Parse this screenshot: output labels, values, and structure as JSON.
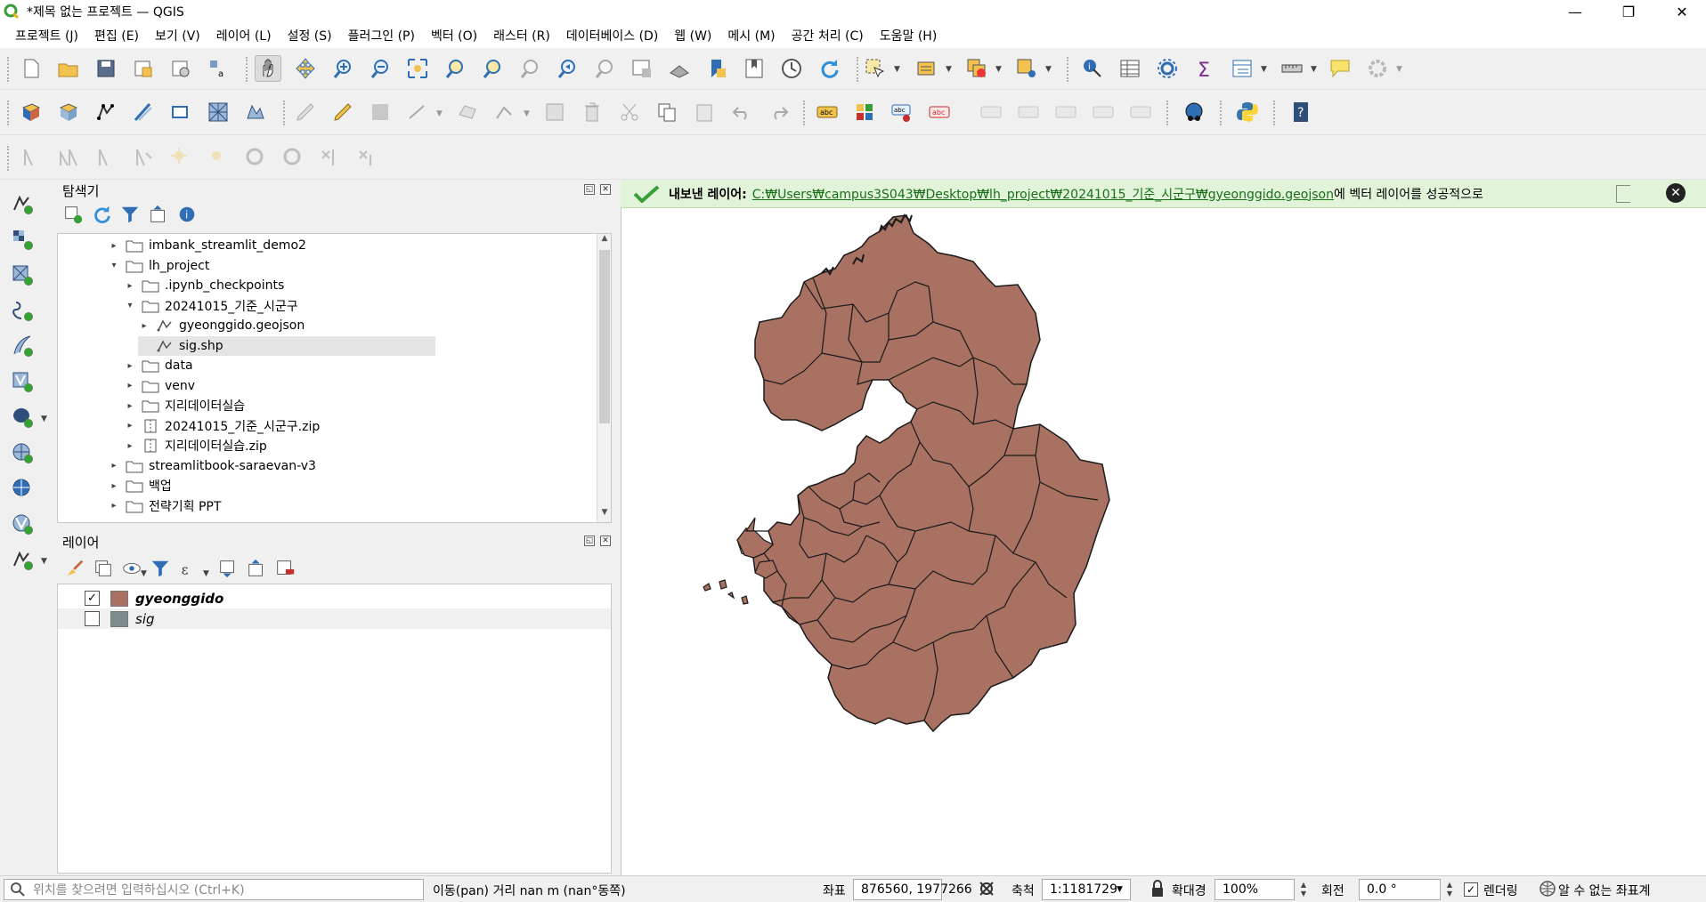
{
  "window": {
    "title": "*제목 없는 프로젝트 — QGIS",
    "app_icon": "qgis-logo",
    "controls": [
      "minimize",
      "restore",
      "close"
    ]
  },
  "menu": [
    "프로젝트 (J)",
    "편집 (E)",
    "보기 (V)",
    "레이어 (L)",
    "설정 (S)",
    "플러그인 (P)",
    "벡터 (O)",
    "래스터 (R)",
    "데이터베이스 (D)",
    "웹 (W)",
    "메시 (M)",
    "공간 처리 (C)",
    "도움말 (H)"
  ],
  "browser_panel": {
    "title": "탐색기",
    "tree": [
      {
        "label": "imbank_streamlit_demo2",
        "arrow": "▸",
        "icon": "folder-icon",
        "selected": false
      },
      {
        "label": "lh_project",
        "arrow": "▾",
        "icon": "folder-icon",
        "selected": false
      },
      {
        "label": ".ipynb_checkpoints",
        "arrow": "▸",
        "icon": "folder-icon",
        "selected": false
      },
      {
        "label": "20241015_기준_시군구",
        "arrow": "▾",
        "icon": "folder-icon",
        "selected": false
      },
      {
        "label": "gyeonggido.geojson",
        "arrow": "▸",
        "icon": "vector-file-icon",
        "selected": false
      },
      {
        "label": "sig.shp",
        "arrow": "",
        "icon": "vector-file-icon",
        "selected": true
      },
      {
        "label": "data",
        "arrow": "▸",
        "icon": "folder-icon",
        "selected": false
      },
      {
        "label": "venv",
        "arrow": "▸",
        "icon": "folder-icon",
        "selected": false
      },
      {
        "label": "지리데이터실습",
        "arrow": "▸",
        "icon": "folder-icon",
        "selected": false
      },
      {
        "label": "20241015_기준_시군구.zip",
        "arrow": "▸",
        "icon": "zip-icon",
        "selected": false
      },
      {
        "label": "지리데이터실습.zip",
        "arrow": "▸",
        "icon": "zip-icon",
        "selected": false
      },
      {
        "label": "streamlitbook-saraevan-v3",
        "arrow": "▸",
        "icon": "folder-icon",
        "selected": false
      },
      {
        "label": "백업",
        "arrow": "▸",
        "icon": "folder-icon",
        "selected": false
      },
      {
        "label": "전략기획 PPT",
        "arrow": "▸",
        "icon": "folder-icon",
        "selected": false
      }
    ]
  },
  "layers_panel": {
    "title": "레이어",
    "layers": [
      {
        "name": "gyeonggido",
        "checked": true,
        "color": "#a87161"
      },
      {
        "name": "sig",
        "checked": false,
        "color": "#7b8a8b"
      }
    ]
  },
  "message_bar": {
    "label": "내보낸 레이어:",
    "path": "C:₩Users₩campus3S043₩Desktop₩lh_project₩20241015_기준_시군구₩gyeonggido.geojson",
    "suffix": "에 벡터 레이어를 성공적으로"
  },
  "map": {
    "fill_color": "#a87161",
    "stroke_color": "#1a1a1a"
  },
  "status": {
    "search_placeholder": "위치를 찾으려면 입력하십시오 (Ctrl+K)",
    "pan_message": "이동(pan) 거리 nan m (nan°동쪽)",
    "coord_label": "좌표",
    "coord_value": "876560, 1977266",
    "scale_label": "축척",
    "scale_value": "1:1181729",
    "magnifier_label": "확대경",
    "magnifier_value": "100%",
    "rotation_label": "회전",
    "rotation_value": "0.0 °",
    "render_label": "렌더링",
    "render_checked": "✓",
    "crs_label": "알 수 없는 좌표계"
  }
}
